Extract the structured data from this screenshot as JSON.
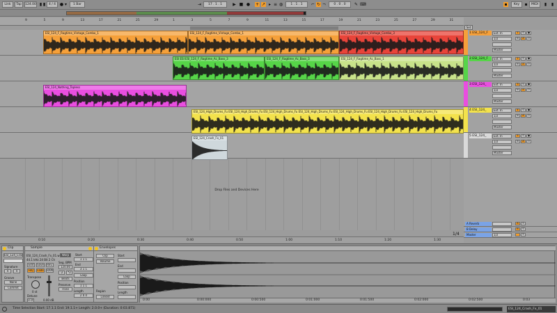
{
  "transport": {
    "link_label": "Link",
    "tap_label": "Tap",
    "tempo": "124.00",
    "meter": "4 / 4",
    "quantize": "1 Bar",
    "position": "17 .  1 .  1",
    "loop_start": "1 .  1 .  1",
    "loop_length": "0 .  0 .  0",
    "key_label": "Key",
    "midi_label": "MIDI",
    "cpu": "0 %"
  },
  "ruler": {
    "bars": [
      "9",
      "5",
      "9",
      "13",
      "17",
      "21",
      "25",
      "29",
      "1",
      "3",
      "5",
      "7",
      "9",
      "11",
      "13",
      "15",
      "17",
      "19",
      "21",
      "23",
      "25",
      "27",
      "29",
      "31"
    ],
    "set_label": "Set"
  },
  "tracks": [
    {
      "name": "1 ESI_124_F",
      "color": "#f5a03a",
      "input": "Ext. In",
      "channel": "1/2",
      "monitor": "Master",
      "clips": [
        {
          "title": "ESI_124_F_Ragtime_Vintage_Combo_1",
          "color": "#f5a03a"
        },
        {
          "title": "ESI_124_F_Ragtime_Vintage_Combo_1",
          "color": "#f5a03a"
        },
        {
          "title": "ESI_124_F_Ragtime_Vintage_Combo_3",
          "color": "#e8443a"
        }
      ]
    },
    {
      "name": "2 ESI_124_F",
      "color": "#56d548",
      "input": "Ext. In",
      "channel": "1/2",
      "monitor": "Master",
      "clips": [
        {
          "title": "ESI ESI ESI_124_F_Ragtime_Ac_Bass_3",
          "color": "#56d548"
        },
        {
          "title": "ESI_124_F_Ragtime_Ac_Bass_3",
          "color": "#56d548"
        },
        {
          "title": "ESI_124_F_Ragtime_Ac_Bass_1",
          "color": "#c8e28a"
        }
      ]
    },
    {
      "name": "3 ESI_124_",
      "color": "#e94ee0",
      "input": "Ext. In",
      "channel": "1/2",
      "monitor": "Master",
      "clips": [
        {
          "title": "ESI_124_Nothing_Topless",
          "color": "#e94ee0"
        }
      ]
    },
    {
      "name": "4 ESI_124_",
      "color": "#f3e24c",
      "input": "Ext. In",
      "channel": "1/2",
      "monitor": "Master",
      "clips": [
        {
          "title": "ESI_124_High_Drums_Fu ESI_124_High_Drums_Fu ESI_124_High_Drums_Fu ESI_124_High_Drums_Fu ESI_124_High_Drums_Fu ESI_124_High_Drums_Fu ESI_124_High_Drums_Fu",
          "color": "#f3e24c"
        }
      ]
    },
    {
      "name": "5 ESI_124_",
      "color": "#d9d9d9",
      "input": "Ext. In",
      "channel": "1/2",
      "monitor": "Master",
      "clips": [
        {
          "title": "ESI_124_Crash_Fx_01",
          "color": "#cfd8dc"
        }
      ]
    }
  ],
  "dropzone_text": "Drop Files and Devices Here",
  "returns": [
    {
      "name": "A Reverb",
      "letter": "A"
    },
    {
      "name": "B Delay",
      "letter": "B"
    },
    {
      "name": "Master",
      "letter": ""
    }
  ],
  "master_channel": "1/2",
  "zoom_fraction": "1/4",
  "timeline": [
    "0:10",
    "0:20",
    "0:30",
    "0:40",
    "0:50",
    "1:00",
    "1:10",
    "1:20",
    "1:30"
  ],
  "clip_panel": {
    "header": "Clip",
    "clip_name": "ESI_124_Cras",
    "signature_label": "Signature",
    "sig_num": "4",
    "sig_den": "4",
    "groove_label": "Groove",
    "groove_value": "None",
    "commit_label": "Commit"
  },
  "sample_panel": {
    "header": "Sample",
    "file_name": "ESI_124_Crash_Fx_01.w",
    "file_info": "44.1 kHz 24 Bit 2 Ch",
    "edit_label": "Edit",
    "save_label": "Save",
    "rev_label": "Rev.",
    "hiq_label": "HiQ",
    "fade_label": "Fade",
    "ram_label": "RAM",
    "warp_label": "Warp",
    "seg_bpm_label": "Seg. BPM",
    "seg_bpm_value": "120.00",
    "half_label": ":2",
    "double_label": "*2",
    "mode_label": "Beats",
    "preserve_label": "Preserve",
    "trans_label": "Trans",
    "transpose_label": "Transpose",
    "transpose_value": "0 st",
    "detune_label": "Detune",
    "detune_value": "0 ct",
    "gain_value": "0.00 dB"
  },
  "region_panel": {
    "start_label": "Start",
    "start_value": "1  1  1",
    "end_label": "End",
    "end_value": "3  1  1",
    "loop_label": "Loop",
    "position_label": "Position",
    "position_value": "1  1  1",
    "length_label": "Length",
    "length_value": "2  0  0",
    "region_label": "Region",
    "linked_label": "Linked"
  },
  "envelopes_panel": {
    "header": "Envelopes",
    "device": "Clip",
    "control": "Volume",
    "start_label": "Start",
    "end_label": "End",
    "loop_label": "Loop",
    "position_label": "Position",
    "length_label": "Length"
  },
  "sample_ruler": [
    "0:00",
    "0:00:000",
    "0:00:500",
    "0:01:000",
    "0:01:500",
    "0:02:000",
    "0:02:500",
    "0:03"
  ],
  "status": {
    "text": "Time Selection   Start: 17.1.1   End: 19.1.1+   Length: 2.0.0+   (Duration: 0:03.871)",
    "clip_name": "ESI_124_Crash_Fx_01"
  }
}
